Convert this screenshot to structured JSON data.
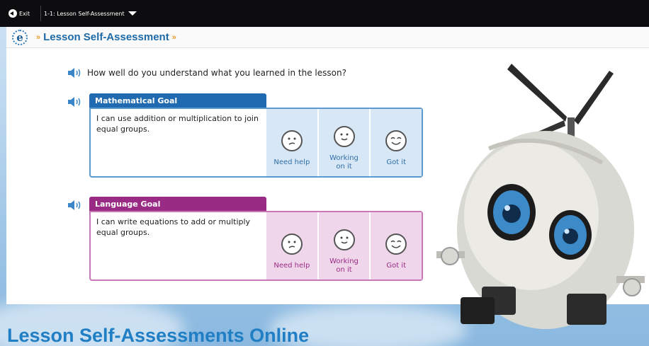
{
  "topbar": {
    "exit_label": "Exit",
    "lesson_label": "1-1: Lesson Self-Assessment"
  },
  "header": {
    "title": "Lesson Self-Assessment"
  },
  "question": "How well do you understand what you learned in the lesson?",
  "goals": [
    {
      "title": "Mathematical Goal",
      "text": "I can use addition or multiplication to join equal groups.",
      "color": "#1f6ab0",
      "ratings": [
        "Need help",
        "Working on it",
        "Got it"
      ]
    },
    {
      "title": "Language Goal",
      "text": "I can write equations to add or multiply equal groups.",
      "color": "#9a2b84",
      "ratings": [
        "Need help",
        "Working on it",
        "Got it"
      ]
    }
  ],
  "caption": "Lesson Self-Assessments Online",
  "icons": [
    "back-arrow-icon",
    "chevron-down-icon",
    "e-logo-icon",
    "speaker-icon",
    "face-need-help-icon",
    "face-working-icon",
    "face-got-it-icon"
  ]
}
